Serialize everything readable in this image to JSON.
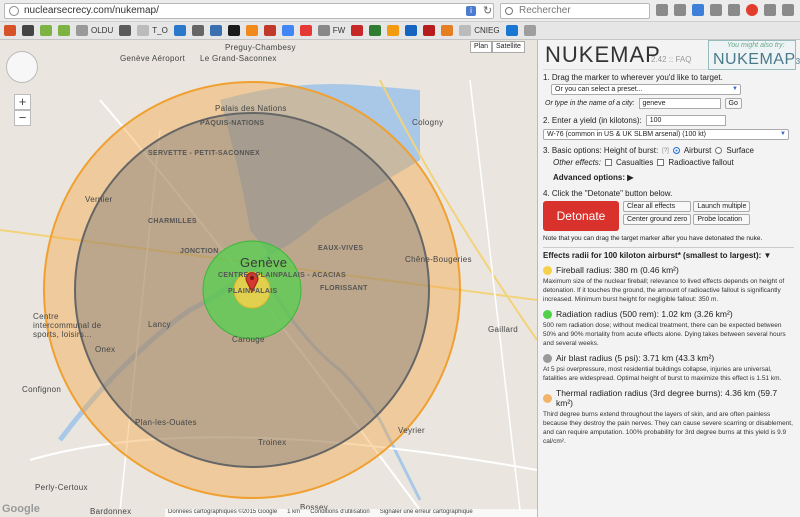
{
  "browser": {
    "url": "nuclearsecrecy.com/nukemap/",
    "search_placeholder": "Rechercher",
    "bookmarks": [
      {
        "label": "",
        "color": "#d6532a"
      },
      {
        "label": "",
        "color": "#444444"
      },
      {
        "label": "",
        "color": "#7cb342"
      },
      {
        "label": "",
        "color": "#7cb342"
      },
      {
        "label": "OLDU",
        "color": "#999999"
      },
      {
        "label": "",
        "color": "#5a5a5a"
      },
      {
        "label": "T_O",
        "color": "#bbbbbb"
      },
      {
        "label": "",
        "color": "#2b77c9"
      },
      {
        "label": "",
        "color": "#666666"
      },
      {
        "label": "",
        "color": "#3a6fb0"
      },
      {
        "label": "",
        "color": "#1b1b1b"
      },
      {
        "label": "",
        "color": "#f08a1c"
      },
      {
        "label": "",
        "color": "#c0392b"
      },
      {
        "label": "",
        "color": "#4285f4"
      },
      {
        "label": "",
        "color": "#e53935"
      },
      {
        "label": "FW",
        "color": "#888888"
      },
      {
        "label": "",
        "color": "#c62828"
      },
      {
        "label": "",
        "color": "#2e7d32"
      },
      {
        "label": "",
        "color": "#f39c12"
      },
      {
        "label": "",
        "color": "#1565c0"
      },
      {
        "label": "",
        "color": "#b71c1c"
      },
      {
        "label": "",
        "color": "#e67e22"
      },
      {
        "label": "CNIEG",
        "color": "#bbbbbb"
      },
      {
        "label": "",
        "color": "#1976d2"
      },
      {
        "label": "",
        "color": "#9e9e9e"
      }
    ]
  },
  "map": {
    "type_buttons": [
      "Plan",
      "Satellite"
    ],
    "city_label": "Genève",
    "labels": [
      {
        "text": "Preguy-Chambesy"
      },
      {
        "text": "Genève Aéroport"
      },
      {
        "text": "Le Grand-Saconnex"
      },
      {
        "text": "PÂQUIS-NATIONS"
      },
      {
        "text": "Palais des Nations"
      },
      {
        "text": "Vernier"
      },
      {
        "text": "SERVETTE - PETIT-SACONNEX"
      },
      {
        "text": "CHARMILLES"
      },
      {
        "text": "EAUX-VIVES"
      },
      {
        "text": "Chêne-Bougeries"
      },
      {
        "text": "Lancy"
      },
      {
        "text": "Carouge"
      },
      {
        "text": "Onex"
      },
      {
        "text": "Confignon"
      },
      {
        "text": "Plan-les-Ouates"
      },
      {
        "text": "Troinex"
      },
      {
        "text": "Perly-Certoux"
      },
      {
        "text": "Bardonnex"
      },
      {
        "text": "Cologny"
      },
      {
        "text": "Gaillard"
      },
      {
        "text": "Veyrier"
      },
      {
        "text": "Bossey"
      },
      {
        "text": "Centre intercommunal de sports, loisirs..."
      },
      {
        "text": "JONCTION"
      },
      {
        "text": "PLAINPALAIS"
      },
      {
        "text": "FLORISSANT"
      },
      {
        "text": "CENTRE - PLAINPALAIS - ACACIAS"
      }
    ],
    "footer": [
      "Données cartographiques ©2015 Google",
      "1 km",
      "Conditions d'utilisation",
      "Signaler une erreur cartographique"
    ],
    "google": "Google",
    "circles": [
      {
        "name": "thermal",
        "radius_km": 4.36,
        "fill": "#f3a440"
      },
      {
        "name": "air-blast",
        "radius_km": 3.71,
        "fill": "#8c8c8c"
      },
      {
        "name": "radiation",
        "radius_km": 1.02,
        "fill": "#4fd14a"
      },
      {
        "name": "fireball",
        "radius_km": 0.38,
        "fill": "#f5d14a"
      }
    ]
  },
  "panel": {
    "brand": "NUKEMAP",
    "version": "2.42 :: FAQ",
    "also_text": "You might also try:",
    "also_brand": "NUKEMAP",
    "also_sub": "3D",
    "step1_title": "1. Drag the marker to wherever you'd like to target.",
    "preset_placeholder": "Or you can select a preset...",
    "city_prompt": "Or type in the name of a city:",
    "city_value": "geneve",
    "go_label": "Go",
    "step2_title": "2. Enter a yield (in kilotons):",
    "yield_value": "100",
    "weapon_select": "W-76 (common in US & UK SLBM arsenal) (100 kt)",
    "step3_title": "3. Basic options: Height of burst:",
    "help": "[?]",
    "airburst": "Airburst",
    "surface": "Surface",
    "other_effects": "Other effects:",
    "casualties": "Casualties",
    "fallout": "Radioactive fallout",
    "advanced": "Advanced options: ▶",
    "step4_title": "4. Click the \"Detonate\" button below.",
    "detonate": "Detonate",
    "clear": "Clear all effects",
    "launch": "Launch multiple",
    "center": "Center ground zero",
    "probe": "Probe location",
    "note": "Note that you can drag the target marker after you have detonated the nuke.",
    "effects_title": "Effects radii for 100 kiloton airburst* (smallest to largest): ▼",
    "effects": [
      {
        "color": "#f5d14a",
        "title": "Fireball radius: 380 m (0.46 km²)",
        "desc": "Maximum size of the nuclear fireball; relevance to lived effects depends on height of detonation. If it touches the ground, the amount of radioactive fallout is significantly increased. Minimum burst height for negligible fallout: 350 m."
      },
      {
        "color": "#4fd14a",
        "title": "Radiation radius (500 rem): 1.02 km (3.26 km²)",
        "desc": "500 rem radiation dose; without medical treatment, there can be expected between 50% and 90% mortality from acute effects alone. Dying takes between several hours and several weeks."
      },
      {
        "color": "#9a9a9a",
        "title": "Air blast radius (5 psi): 3.71 km (43.3 km²)",
        "desc": "At 5 psi overpressure, most residential buildings collapse, injuries are universal, fatalities are widespread. Optimal height of burst to maximize this effect is 1.51 km."
      },
      {
        "color": "#f3b46a",
        "title": "Thermal radiation radius (3rd degree burns): 4.36 km (59.7 km²)",
        "desc": "Third degree burns extend throughout the layers of skin, and are often painless because they destroy the pain nerves. They can cause severe scarring or disablement, and can require amputation. 100% probability for 3rd degree burns at this yield is 9.9 cal/cm²."
      }
    ]
  }
}
